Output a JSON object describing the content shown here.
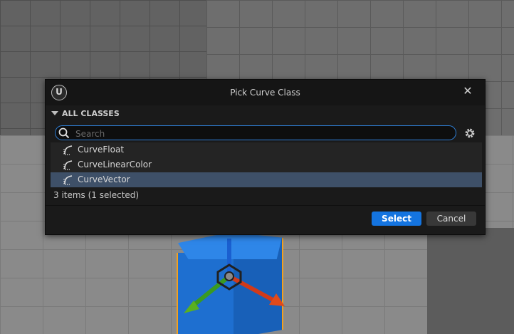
{
  "dialog": {
    "title": "Pick Curve Class",
    "logo_letter": "U",
    "close_glyph": "✕"
  },
  "section": {
    "header": "ALL CLASSES"
  },
  "search": {
    "placeholder": "Search",
    "value": ""
  },
  "list": {
    "items": [
      {
        "label": "CurveFloat",
        "icon": "curve-icon",
        "selected": false
      },
      {
        "label": "CurveLinearColor",
        "icon": "curve-icon",
        "selected": false
      },
      {
        "label": "CurveVector",
        "icon": "curve-icon",
        "selected": true
      }
    ]
  },
  "status": {
    "text": "3 items (1 selected)"
  },
  "buttons": {
    "select_label": "Select",
    "cancel_label": "Cancel"
  },
  "colors": {
    "accent": "#1474e0",
    "selection": "#3e5068",
    "dialog_bg": "#1a1a1a"
  }
}
